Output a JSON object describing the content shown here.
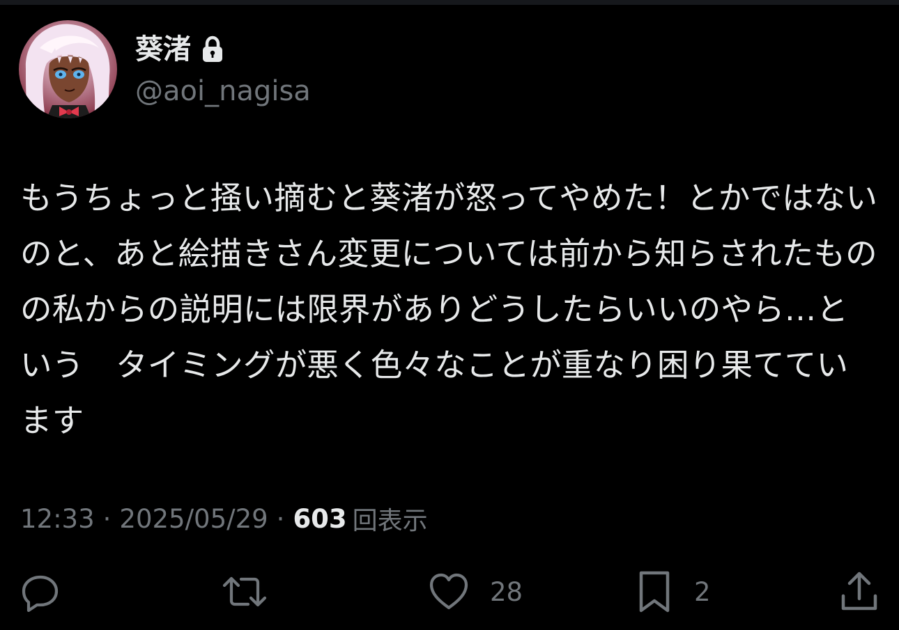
{
  "author": {
    "display_name": "葵渚",
    "handle": "@aoi_nagisa",
    "avatar": "anime-girl-avatar",
    "protected_icon": "lock-icon"
  },
  "tweet": {
    "text": "もうちょっと掻い摘むと葵渚が怒ってやめた！とかではないのと、あと絵描きさん変更については前から知らされたものの私からの説明には限界がありどうしたらいいのやら…という　タイミングが悪く色々なことが重なり困り果てています"
  },
  "meta": {
    "time": "12:33",
    "separator": "·",
    "date": "2025/05/29",
    "views_count": "603",
    "views_label": "回表示"
  },
  "actions": {
    "reply_icon": "reply-icon",
    "retweet_icon": "retweet-icon",
    "like_icon": "heart-icon",
    "like_count": "28",
    "bookmark_icon": "bookmark-icon",
    "bookmark_count": "2",
    "share_icon": "share-icon"
  },
  "colors": {
    "background": "#000000",
    "primary_text": "#e7e9ea",
    "secondary_text": "#71767b"
  }
}
